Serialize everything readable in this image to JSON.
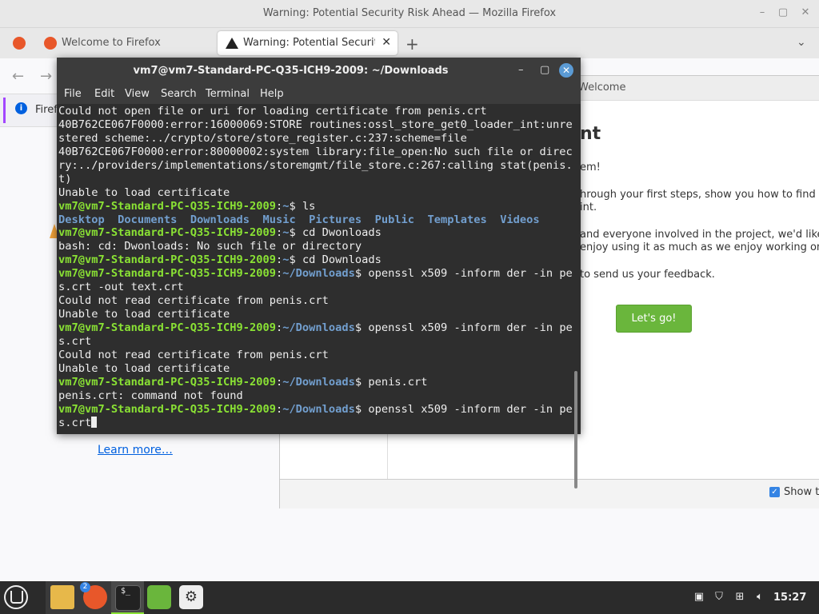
{
  "firefox": {
    "window_title": "Warning: Potential Security Risk Ahead — Mozilla Firefox",
    "tabs": [
      {
        "label": "Welcome to Firefox"
      },
      {
        "label": "Warning: Potential Security Risk Ahead"
      }
    ],
    "new_tab": "+",
    "notice_text": "Firef",
    "learn_more": "Learn more…"
  },
  "welcome_dialog": {
    "header_title": "Welcome",
    "heading": "nt",
    "lines": [
      "em!",
      "hrough your first steps, show you how to find hel",
      "int.",
      "and everyone involved in the project, we'd like to t",
      "enjoy using it as much as we enjoy working on it.",
      "to send us your feedback."
    ],
    "lets_go": "Let's go!",
    "show_label": "Show th"
  },
  "terminal": {
    "title": "vm7@vm7-Standard-PC-Q35-ICH9-2009: ~/Downloads",
    "menu": [
      "File",
      "Edit",
      "View",
      "Search",
      "Terminal",
      "Help"
    ],
    "prompt_user": "vm7@vm7-Standard-PC-Q35-ICH9-2009",
    "home": "~",
    "downloads": "~/Downloads",
    "lines": {
      "l0": "Could not open file or uri for loading certificate from penis.crt",
      "l1": "40B762CE067F0000:error:16000069:STORE routines:ossl_store_get0_loader_int:unregi",
      "l2": "stered scheme:../crypto/store/store_register.c:237:scheme=file",
      "l3": "40B762CE067F0000:error:80000002:system library:file_open:No such file or directo",
      "l4": "ry:../providers/implementations/storemgmt/file_store.c:267:calling stat(penis.cr",
      "l5": "t)",
      "l6": "Unable to load certificate",
      "l7_cmd": "ls",
      "dirs": [
        "Desktop",
        "Documents",
        "Downloads",
        "Music",
        "Pictures",
        "Public",
        "Templates",
        "Videos"
      ],
      "l9_cmd": "cd Dwonloads",
      "l10": "bash: cd: Dwonloads: No such file or directory",
      "l11_cmd": "cd Downloads",
      "l12_cmd": "openssl x509 -inform der -in peni",
      "l13": "s.crt -out text.crt",
      "l14": "Could not read certificate from penis.crt",
      "l15": "Unable to load certificate",
      "l16_cmd": "openssl x509 -inform der -in peni",
      "l17": "s.crt",
      "l18": "Could not read certificate from penis.crt",
      "l19": "Unable to load certificate",
      "l20_cmd": "penis.crt",
      "l21": "penis.crt: command not found",
      "l22_cmd": "openssl x509 -inform der -in peni",
      "l23": "s.crt"
    }
  },
  "taskbar": {
    "firefox_badge": "2",
    "clock": "15:27"
  },
  "colors": {
    "prompt_green": "#8ae234",
    "path_blue": "#729fcf",
    "terminal_bg": "#2e2e2e",
    "accent_green": "#6ab63c"
  }
}
